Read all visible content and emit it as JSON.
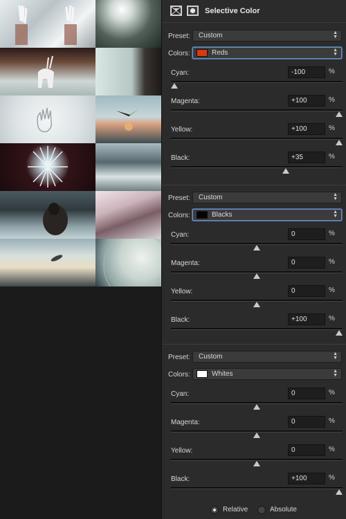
{
  "header": {
    "title": "Selective Color"
  },
  "gallery": {
    "tiles": [
      {
        "name": "hands-smoke-tile",
        "bg": "linear-gradient(135deg,#e9eef0,#b9c3c7 40%,#f2f4f5 70%,#9aa4a8)",
        "accent": "#b07060"
      },
      {
        "name": "sky-landscape-tile",
        "bg": "radial-gradient(circle at 40% 20%,#ffffff 0%,#cfd8d4 20%,#526058 55%,#1f2a26 100%)"
      },
      {
        "name": "white-creature-tile",
        "bg": "linear-gradient(180deg,#2a1a18 0%,#6b4a3a 30%,#cfd8d6 70%,#a9b8b6 100%)"
      },
      {
        "name": "dark-figure-tile",
        "bg": "linear-gradient(90deg,#d8e6e4 0%,#b7c7c4 55%,#3a3532 75%,#1e1a18 100%)"
      },
      {
        "name": "snow-handprint-tile",
        "bg": "radial-gradient(circle at 50% 50%,#f3f5f6 0%,#dde3e5 60%,#c4ccd0 100%)"
      },
      {
        "name": "bird-fire-tile",
        "bg": "linear-gradient(180deg,#9fb8c0 0%,#c8d7d9 45%,#d9a080 60%,#3d4c52 100%)"
      },
      {
        "name": "ice-crystal-tile",
        "bg": "radial-gradient(circle at 50% 45%,#ffffff 0%,#c4d4da 12%,#311318 40%,#1c0a0d 100%)"
      },
      {
        "name": "frozen-cliffs-tile",
        "bg": "linear-gradient(180deg,#a9bcc2 0%,#56686e 40%,#d9e3e5 70%,#6e7f84 100%)"
      },
      {
        "name": "embrace-rocks-tile",
        "bg": "linear-gradient(180deg,#4b5a60 0%,#2f3a3e 40%,#8fa3a8 75%,#c3d1d4 100%)"
      },
      {
        "name": "pink-mountains-tile",
        "bg": "linear-gradient(160deg,#f1e2e6 0%,#cbb4bb 35%,#7a5e66 60%,#d9d4d6 100%)"
      },
      {
        "name": "flying-object-tile",
        "bg": "linear-gradient(180deg,#9ab0b6 0%,#d7dfdd 35%,#e8ddc4 60%,#3e4748 100%)"
      },
      {
        "name": "planet-tile",
        "bg": "radial-gradient(circle at 70% 40%,#eef2ee 0%,#c8d4cf 40%,#90a5a3 70%,#2c3d46 100%)"
      }
    ]
  },
  "groups": [
    {
      "preset_label": "Preset:",
      "preset_value": "Custom",
      "colors_label": "Colors:",
      "colors_value": "Reds",
      "swatch": "#d83a12",
      "active": true,
      "sliders": [
        {
          "label": "Cyan:",
          "value": "-100",
          "pct": "%",
          "level": -100
        },
        {
          "label": "Magenta:",
          "value": "+100",
          "pct": "%",
          "level": 100
        },
        {
          "label": "Yellow:",
          "value": "+100",
          "pct": "%",
          "level": 100
        },
        {
          "label": "Black:",
          "value": "+35",
          "pct": "%",
          "level": 35
        }
      ]
    },
    {
      "preset_label": "Preset:",
      "preset_value": "Custom",
      "colors_label": "Colors:",
      "colors_value": "Blacks",
      "swatch": "#050505",
      "active": true,
      "sliders": [
        {
          "label": "Cyan:",
          "value": "0",
          "pct": "%",
          "level": 0
        },
        {
          "label": "Magenta:",
          "value": "0",
          "pct": "%",
          "level": 0
        },
        {
          "label": "Yellow:",
          "value": "0",
          "pct": "%",
          "level": 0
        },
        {
          "label": "Black:",
          "value": "+100",
          "pct": "%",
          "level": 100
        }
      ]
    },
    {
      "preset_label": "Preset:",
      "preset_value": "Custom",
      "colors_label": "Colors:",
      "colors_value": "Whites",
      "swatch": "#ffffff",
      "active": false,
      "sliders": [
        {
          "label": "Cyan:",
          "value": "0",
          "pct": "%",
          "level": 0
        },
        {
          "label": "Magenta:",
          "value": "0",
          "pct": "%",
          "level": 0
        },
        {
          "label": "Yellow:",
          "value": "0",
          "pct": "%",
          "level": 0
        },
        {
          "label": "Black:",
          "value": "+100",
          "pct": "%",
          "level": 100
        }
      ]
    }
  ],
  "method": {
    "relative_label": "Relative",
    "absolute_label": "Absolute",
    "selected": "relative"
  },
  "icons": {
    "adjustment_icon": "selective-color-icon",
    "mask_icon": "layer-mask-icon",
    "dropdown_icon": "updown-arrows-icon"
  }
}
